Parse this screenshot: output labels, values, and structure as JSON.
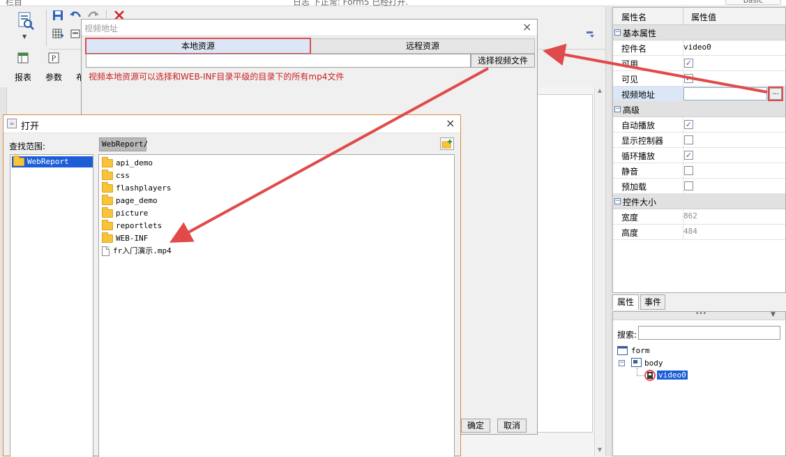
{
  "top_bar": {
    "left_text": "栏目",
    "center_text": "日志 下正常: Form5 已经打开.",
    "right_text": "basic"
  },
  "toolbar": {
    "report_label": "报表",
    "param_label": "参数",
    "layout_label_partial": "布"
  },
  "video_dialog": {
    "title": "视频地址",
    "close_glyph": "×",
    "tab_local": "本地资源",
    "tab_remote": "远程资源",
    "path_value": "",
    "select_button": "选择视频文件",
    "hint": "视频本地资源可以选择和WEB-INF目录平级的目录下的所有mp4文件",
    "ok_button": "确定",
    "cancel_button": "取消"
  },
  "open_dialog": {
    "title": "打开",
    "close_glyph": "×",
    "look_in_label": "查找范围:",
    "look_in_value": "WebReport/",
    "nav_selected": "WebReport",
    "files": [
      {
        "name": "api_demo",
        "kind": "folder"
      },
      {
        "name": "css",
        "kind": "folder"
      },
      {
        "name": "flashplayers",
        "kind": "folder"
      },
      {
        "name": "page_demo",
        "kind": "folder"
      },
      {
        "name": "picture",
        "kind": "folder"
      },
      {
        "name": "reportlets",
        "kind": "folder"
      },
      {
        "name": "WEB-INF",
        "kind": "folder"
      },
      {
        "name": "fr入门演示.mp4",
        "kind": "file"
      }
    ]
  },
  "properties": {
    "header_name": "属性名",
    "header_value": "属性值",
    "group_basic": "基本属性",
    "widget_name_label": "控件名",
    "widget_name_value": "video0",
    "enabled_label": "可用",
    "visible_label": "可见",
    "video_url_label": "视频地址",
    "video_url_button": "...",
    "group_advanced": "高级",
    "autoplay_label": "自动播放",
    "show_controls_label": "显示控制器",
    "loop_label": "循环播放",
    "mute_label": "静音",
    "preload_label": "预加载",
    "group_size": "控件大小",
    "width_label": "宽度",
    "width_value": "862",
    "height_label": "高度",
    "height_value": "484",
    "checkbox_states": {
      "enabled": true,
      "visible": true,
      "autoplay": true,
      "show_controls": false,
      "loop": true,
      "mute": false,
      "preload": false
    }
  },
  "bottom_tabs": {
    "attributes": "属性",
    "events": "事件"
  },
  "tree": {
    "search_label": "搜索:",
    "search_value": "",
    "nodes": {
      "form": "form",
      "body": "body",
      "video": "video0"
    }
  },
  "colors": {
    "annotation_red": "#e14a4a",
    "selection_blue": "#1c5ed6",
    "hint_red": "#cc1d1d"
  }
}
